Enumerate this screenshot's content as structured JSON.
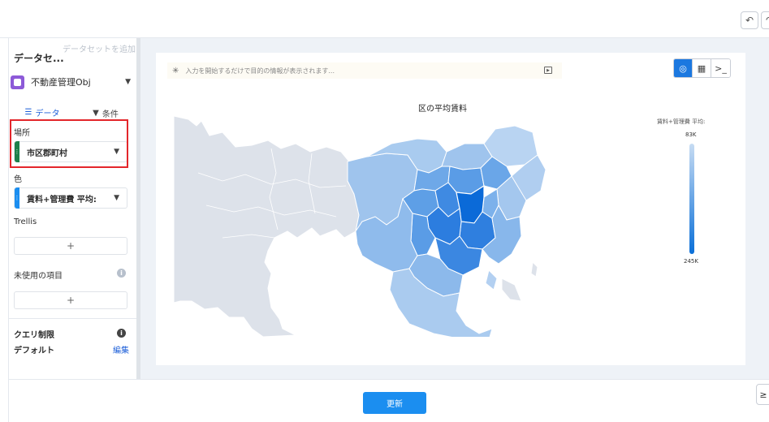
{
  "toolbar": {
    "undo_icon": "undo-icon",
    "redo_icon": "redo-icon"
  },
  "sidebar": {
    "dataset_title": "データセ...",
    "add_dataset": "データセットを追加",
    "object_label": "不動産管理Obj",
    "tabs": [
      {
        "label": "データ",
        "icon": "list-icon"
      },
      {
        "label": "条件",
        "icon": "filter-icon"
      }
    ],
    "location_label": "場所",
    "location_field": "市区郡町村",
    "color_label": "色",
    "color_field": "賃料+管理費 平均:",
    "trellis_label": "Trellis",
    "add_symbol": "+",
    "unused_label": "未使用の項目",
    "query_limit_label": "クエリ制限",
    "default_label": "デフォルト",
    "edit_label": "編集",
    "location_color": "#1e7f4a",
    "color_field_color": "#1b8ef0"
  },
  "main": {
    "search_placeholder": "入力を開始するだけで目的の情報が表示されます...",
    "view_icons": [
      "globe-icon",
      "table-icon",
      "console-icon"
    ],
    "update_button": "更新"
  },
  "chart_data": {
    "type": "choropleth-map",
    "title": "区の平均賃料",
    "legend_title": "賃料+管理費 平均:",
    "legend_top": "83K",
    "legend_bottom": "245K",
    "colors": {
      "low": "#c7dcf3",
      "high": "#0a6fd8",
      "no_data": "#dde2ea"
    }
  }
}
